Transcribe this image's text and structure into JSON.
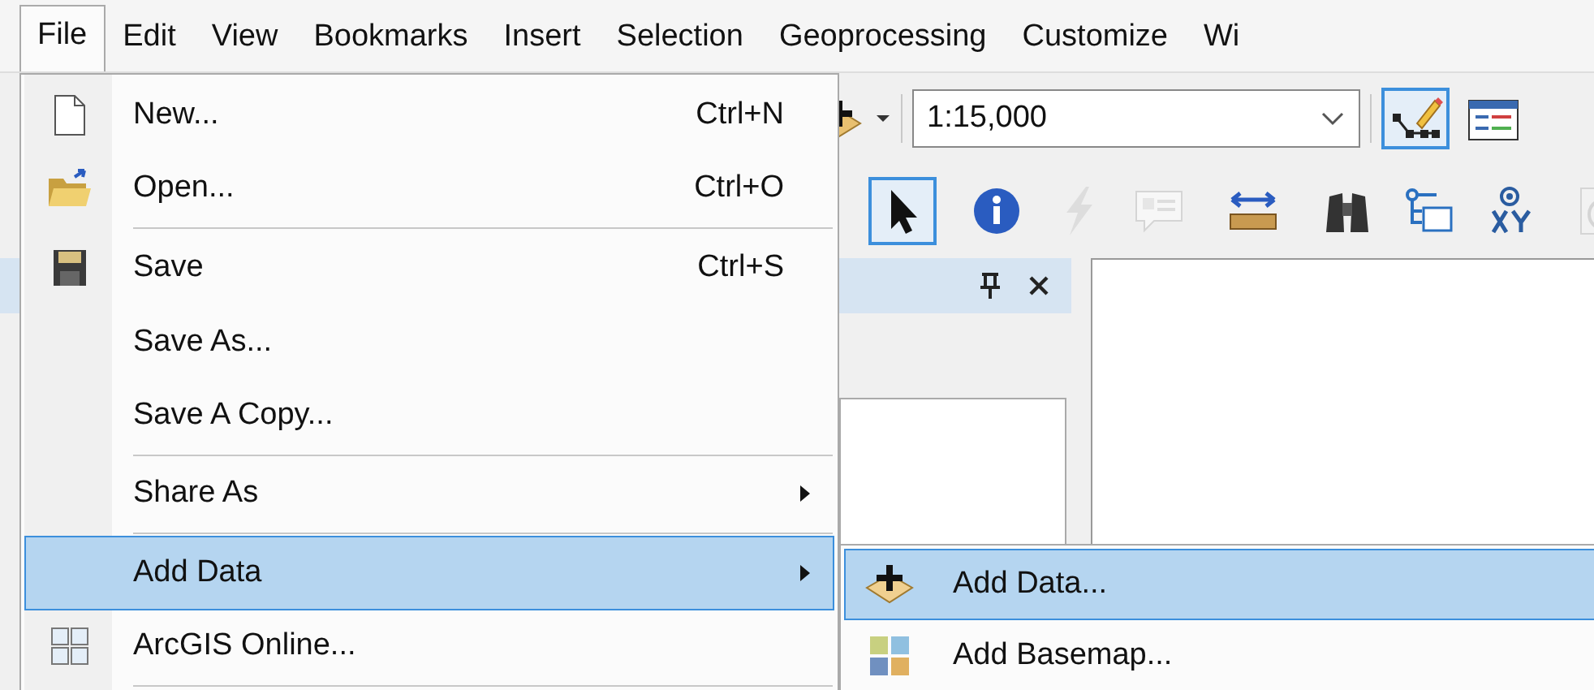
{
  "menubar": [
    {
      "label": "File",
      "selected": true
    },
    {
      "label": "Edit",
      "selected": false
    },
    {
      "label": "View",
      "selected": false
    },
    {
      "label": "Bookmarks",
      "selected": false
    },
    {
      "label": "Insert",
      "selected": false
    },
    {
      "label": "Selection",
      "selected": false
    },
    {
      "label": "Geoprocessing",
      "selected": false
    },
    {
      "label": "Customize",
      "selected": false
    },
    {
      "label": "Wi",
      "selected": false
    }
  ],
  "toolbar_1": {
    "scale_field": {
      "value": "1:15,000"
    },
    "tools": [
      {
        "selected": true,
        "disabled": false
      },
      {
        "selected": false,
        "disabled": false
      }
    ]
  },
  "toolbar_2": {
    "tools": [
      {
        "selected": true,
        "disabled": false
      },
      {
        "selected": false,
        "disabled": false
      },
      {
        "selected": false,
        "disabled": true
      },
      {
        "selected": false,
        "disabled": true
      },
      {
        "selected": false,
        "disabled": false
      },
      {
        "selected": false,
        "disabled": false
      },
      {
        "selected": false,
        "disabled": false
      },
      {
        "selected": false,
        "disabled": false
      },
      {
        "selected": false,
        "disabled": true
      }
    ]
  },
  "file_menu": [
    {
      "label": "New...",
      "shortcut": "Ctrl+N",
      "submenu": false,
      "separator_after": false,
      "selected": false
    },
    {
      "label": "Open...",
      "shortcut": "Ctrl+O",
      "submenu": false,
      "separator_after": true,
      "selected": false
    },
    {
      "label": "Save",
      "shortcut": "Ctrl+S",
      "submenu": false,
      "separator_after": false,
      "selected": false
    },
    {
      "label": "Save As...",
      "submenu": false,
      "separator_after": false,
      "selected": false
    },
    {
      "label": "Save A Copy...",
      "submenu": false,
      "separator_after": true,
      "selected": false
    },
    {
      "label": "Share As",
      "submenu": true,
      "separator_after": true,
      "selected": false
    },
    {
      "label": "Add Data",
      "submenu": true,
      "separator_after": false,
      "selected": true
    },
    {
      "label": "ArcGIS Online...",
      "submenu": false,
      "separator_after": true,
      "selected": false
    }
  ],
  "add_data_submenu": [
    {
      "label": "Add Data...",
      "selected": true
    },
    {
      "label": "Add Basemap...",
      "selected": false
    }
  ]
}
